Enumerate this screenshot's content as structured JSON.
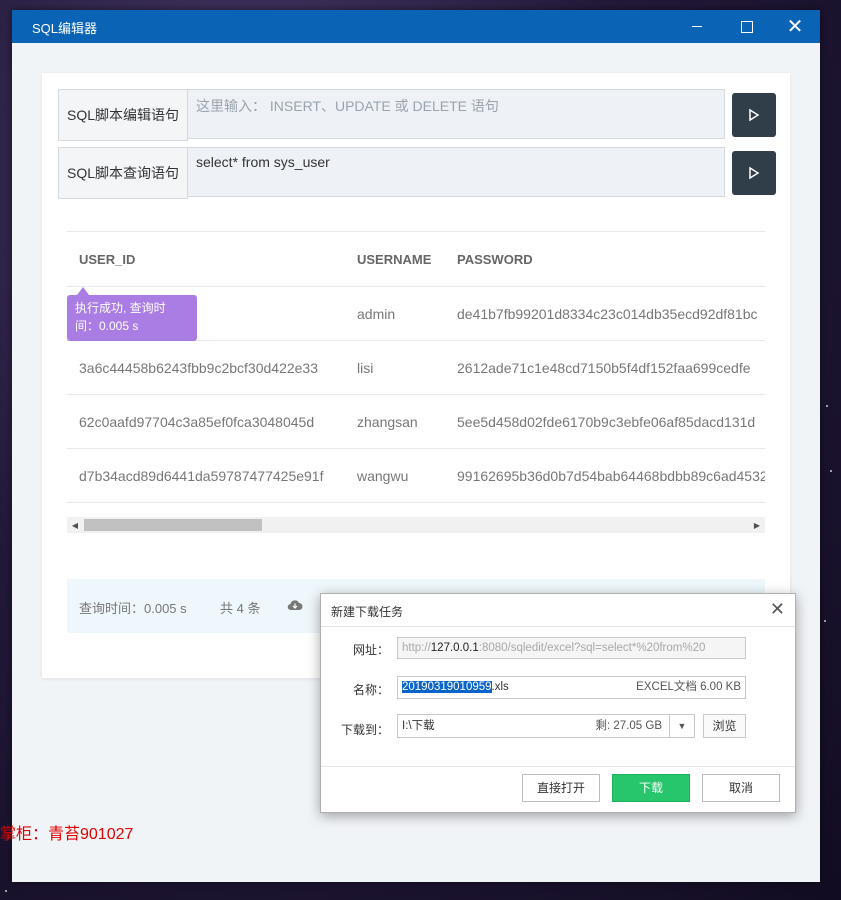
{
  "window": {
    "title": "SQL编辑器"
  },
  "editor": {
    "label": "SQL脚本编辑语句",
    "placeholder": "这里输入： INSERT、UPDATE 或 DELETE 语句",
    "value": ""
  },
  "query": {
    "label": "SQL脚本查询语句",
    "value": "select* from sys_user"
  },
  "table": {
    "columns": [
      "USER_ID",
      "USERNAME",
      "PASSWORD"
    ],
    "rows": [
      [
        "",
        "admin",
        "de41b7fb99201d8334c23c014db35ecd92df81bc"
      ],
      [
        "3a6c44458b6243fbb9c2bcf30d422e33",
        "lisi",
        "2612ade71c1e48cd7150b5f4df152faa699cedfe"
      ],
      [
        "62c0aafd97704c3a85ef0fca3048045d",
        "zhangsan",
        "5ee5d458d02fde6170b9c3ebfe06af85dacd131d"
      ],
      [
        "d7b34acd89d6441da59787477425e91f",
        "wangwu",
        "99162695b36d0b7d54bab64468bdbb89c6ad4532"
      ]
    ]
  },
  "tooltip": {
    "text": "执行成功, 查询时间：0.005 s"
  },
  "footer": {
    "query_time": "查询时间：0.005 s",
    "count": "共 4 条"
  },
  "signature": "掌柜：青苔901027",
  "dialog": {
    "title": "新建下载任务",
    "url_label": "网址：",
    "url_prefix": "http://",
    "url_host": "127.0.0.1",
    "url_rest": ":8080/sqledit/excel?sql=select*%20from%20",
    "name_label": "名称：",
    "name_selected": "20190319010959",
    "name_ext": ".xls",
    "name_meta": "EXCEL文档 6.00 KB",
    "dir_label": "下载到：",
    "dir_value": "I:\\下载",
    "dir_free": "剩: 27.05 GB",
    "browse_label": "浏览",
    "open_label": "直接打开",
    "download_label": "下载",
    "cancel_label": "取消"
  },
  "colors": {
    "titlebar": "#0b63b6",
    "run_button": "#2f3e48",
    "tooltip": "#a97de4",
    "download_button": "#27c56c"
  }
}
